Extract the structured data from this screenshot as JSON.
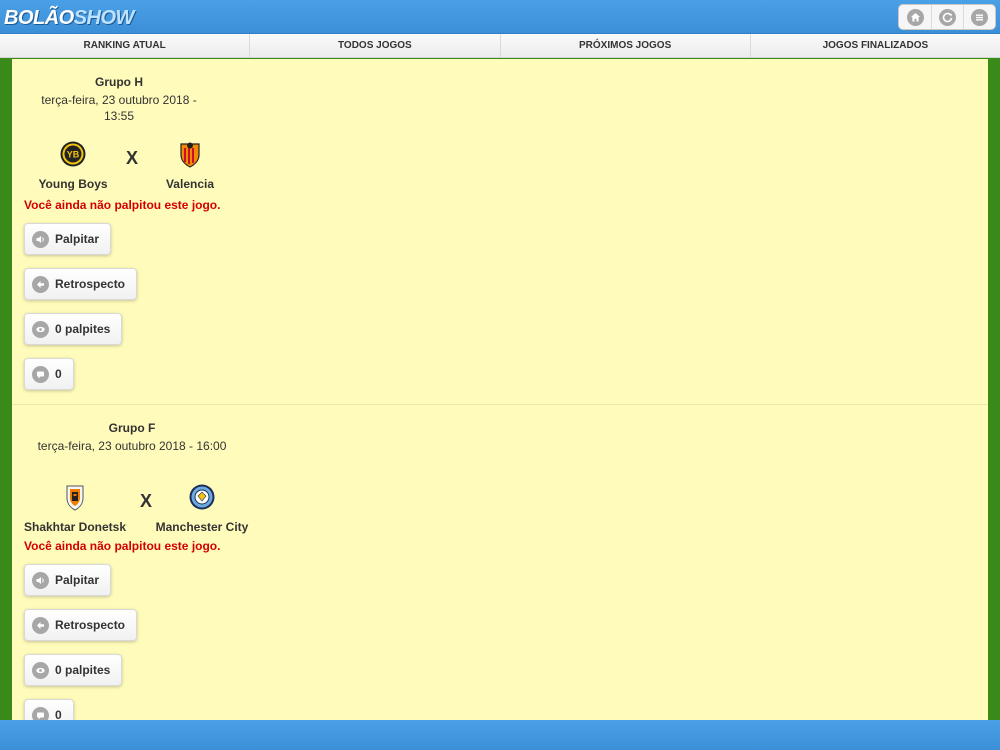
{
  "app": {
    "logo_part1": "BOLÃO",
    "logo_part2": "SHOW"
  },
  "top_actions": [
    {
      "icon": "home-icon"
    },
    {
      "icon": "refresh-icon"
    },
    {
      "icon": "menu-icon"
    }
  ],
  "tabs": [
    "RANKING ATUAL",
    "TODOS JOGOS",
    "PRÓXIMOS JOGOS",
    "JOGOS FINALIZADOS"
  ],
  "games": [
    {
      "group": "Grupo H",
      "datetime": "terça-feira, 23 outubro 2018 - 13:55",
      "home": {
        "name": "Young Boys",
        "crest": "young-boys-crest-icon"
      },
      "vs": "X",
      "away": {
        "name": "Valencia",
        "crest": "valencia-crest-icon"
      },
      "warning": "Você ainda não palpitou este jogo.",
      "buttons": {
        "palpitar": "Palpitar",
        "retrospecto": "Retrospecto",
        "palpites": "0 palpites",
        "comments": "0"
      }
    },
    {
      "group": "Grupo F",
      "datetime": "terça-feira, 23 outubro 2018 - 16:00",
      "home": {
        "name": "Shakhtar Donetsk",
        "crest": "shakhtar-crest-icon"
      },
      "vs": "X",
      "away": {
        "name": "Manchester City",
        "crest": "manchester-city-crest-icon"
      },
      "warning": "Você ainda não palpitou este jogo.",
      "buttons": {
        "palpitar": "Palpitar",
        "retrospecto": "Retrospecto",
        "palpites": "0 palpites",
        "comments": "0"
      }
    }
  ],
  "colors": {
    "header": "#3b8fd6",
    "content_bg": "#fffbbb",
    "side_bg": "#3a8a1a",
    "warning": "#d40000"
  }
}
